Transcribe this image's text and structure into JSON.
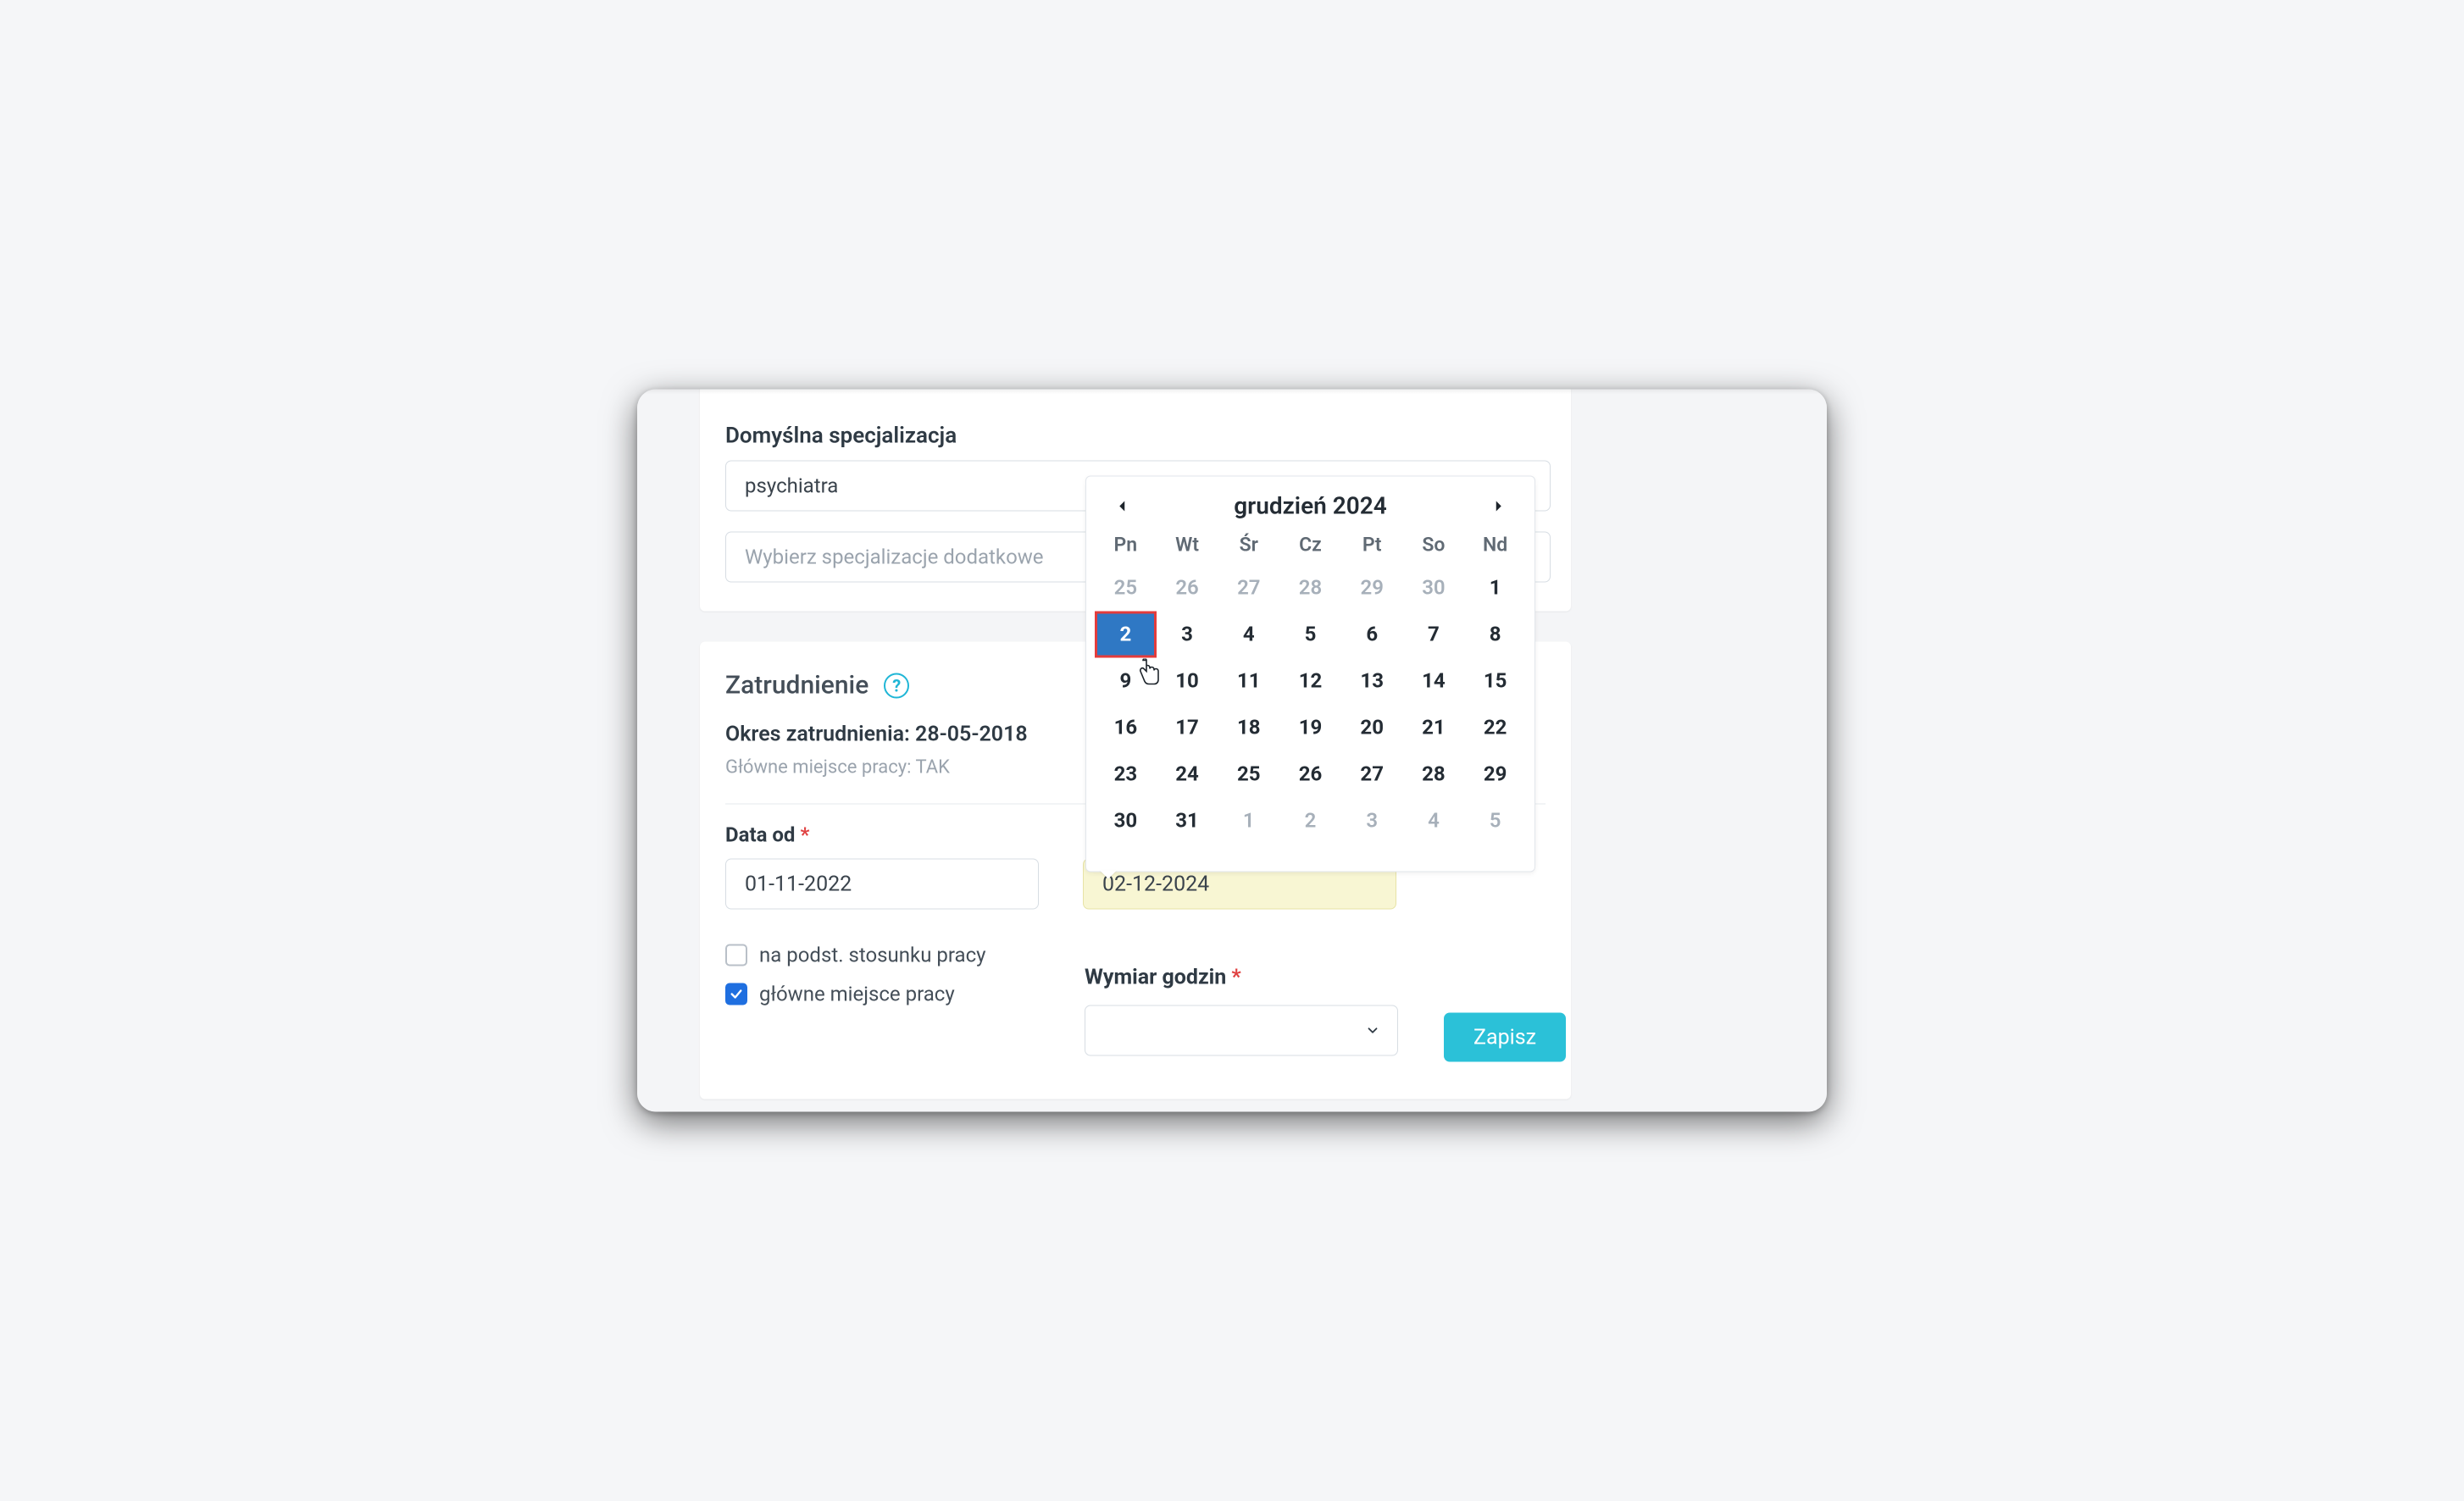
{
  "spec": {
    "label": "Domyślna specjalizacja",
    "main_value": "psychiatra",
    "additional_placeholder": "Wybierz specjalizacje dodatkowe"
  },
  "employment": {
    "title": "Zatrudnienie",
    "period_label": "Okres zatrudnienia:",
    "period_value": "28-05-2018",
    "main_workplace_label": "Główne miejsce pracy:",
    "main_workplace_value": "TAK",
    "date_from_label": "Data od",
    "date_from_value": "01-11-2022",
    "date_to_value": "02-12-2024",
    "checkbox_contract": "na podst. stosunku pracy",
    "checkbox_main": "główne miejsce pracy",
    "hours_label": "Wymiar godzin",
    "save_label": "Zapisz"
  },
  "datepicker": {
    "month_title": "grudzień 2024",
    "dow": [
      "Pn",
      "Wt",
      "Śr",
      "Cz",
      "Pt",
      "So",
      "Nd"
    ],
    "cells": [
      {
        "d": "25",
        "out": true
      },
      {
        "d": "26",
        "out": true
      },
      {
        "d": "27",
        "out": true
      },
      {
        "d": "28",
        "out": true
      },
      {
        "d": "29",
        "out": true
      },
      {
        "d": "30",
        "out": true
      },
      {
        "d": "1"
      },
      {
        "d": "2",
        "sel": true
      },
      {
        "d": "3"
      },
      {
        "d": "4"
      },
      {
        "d": "5"
      },
      {
        "d": "6"
      },
      {
        "d": "7"
      },
      {
        "d": "8"
      },
      {
        "d": "9"
      },
      {
        "d": "10"
      },
      {
        "d": "11"
      },
      {
        "d": "12"
      },
      {
        "d": "13"
      },
      {
        "d": "14"
      },
      {
        "d": "15"
      },
      {
        "d": "16"
      },
      {
        "d": "17"
      },
      {
        "d": "18"
      },
      {
        "d": "19"
      },
      {
        "d": "20"
      },
      {
        "d": "21"
      },
      {
        "d": "22"
      },
      {
        "d": "23"
      },
      {
        "d": "24"
      },
      {
        "d": "25"
      },
      {
        "d": "26"
      },
      {
        "d": "27"
      },
      {
        "d": "28"
      },
      {
        "d": "29"
      },
      {
        "d": "30"
      },
      {
        "d": "31"
      },
      {
        "d": "1",
        "out": true
      },
      {
        "d": "2",
        "out": true
      },
      {
        "d": "3",
        "out": true
      },
      {
        "d": "4",
        "out": true
      },
      {
        "d": "5",
        "out": true
      }
    ]
  }
}
